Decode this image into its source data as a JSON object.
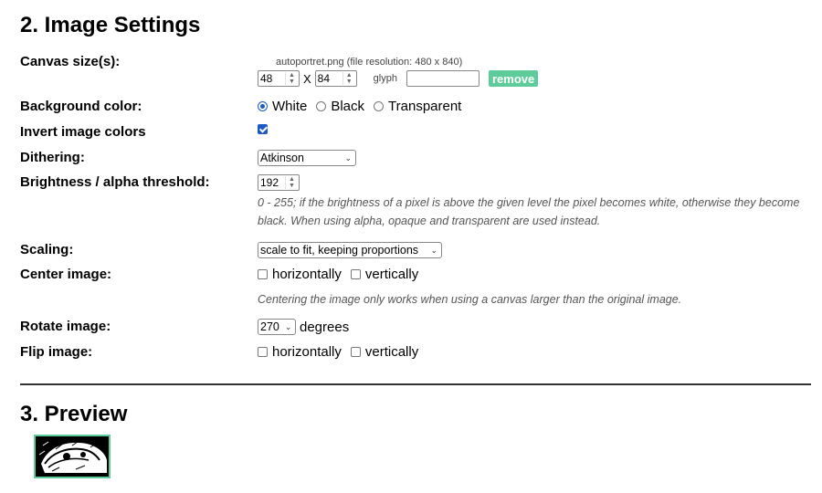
{
  "section2": {
    "title": "2. Image Settings"
  },
  "canvas": {
    "label": "Canvas size(s):",
    "file_info": "autoportret.png (file resolution: 480 x 840)",
    "width": "48",
    "times": "X",
    "height": "84",
    "glyph_label": "glyph",
    "glyph_value": "",
    "remove_label": "remove"
  },
  "background": {
    "label": "Background color:",
    "options": [
      {
        "label": "White",
        "selected": true
      },
      {
        "label": "Black",
        "selected": false
      },
      {
        "label": "Transparent",
        "selected": false
      }
    ]
  },
  "invert": {
    "label": "Invert image colors",
    "checked": true
  },
  "dithering": {
    "label": "Dithering:",
    "value": "Atkinson"
  },
  "threshold": {
    "label": "Brightness / alpha threshold:",
    "value": "192",
    "note": "0 - 255; if the brightness of a pixel is above the given level the pixel becomes white, otherwise they become black. When using alpha, opaque and transparent are used instead."
  },
  "scaling": {
    "label": "Scaling:",
    "value": "scale to fit, keeping proportions"
  },
  "center": {
    "label": "Center image:",
    "horizontal_label": "horizontally",
    "vertical_label": "vertically",
    "note": "Centering the image only works when using a canvas larger than the original image."
  },
  "rotate": {
    "label": "Rotate image:",
    "value": "270",
    "unit": "degrees"
  },
  "flip": {
    "label": "Flip image:",
    "horizontal_label": "horizontally",
    "vertical_label": "vertically"
  },
  "section3": {
    "title": "3. Preview"
  },
  "colors": {
    "accent": "#5ecc9a",
    "control_blue": "#1a5ac7"
  },
  "icons": {
    "spin": "up-down-arrows",
    "dropdown": "chevron-down"
  }
}
